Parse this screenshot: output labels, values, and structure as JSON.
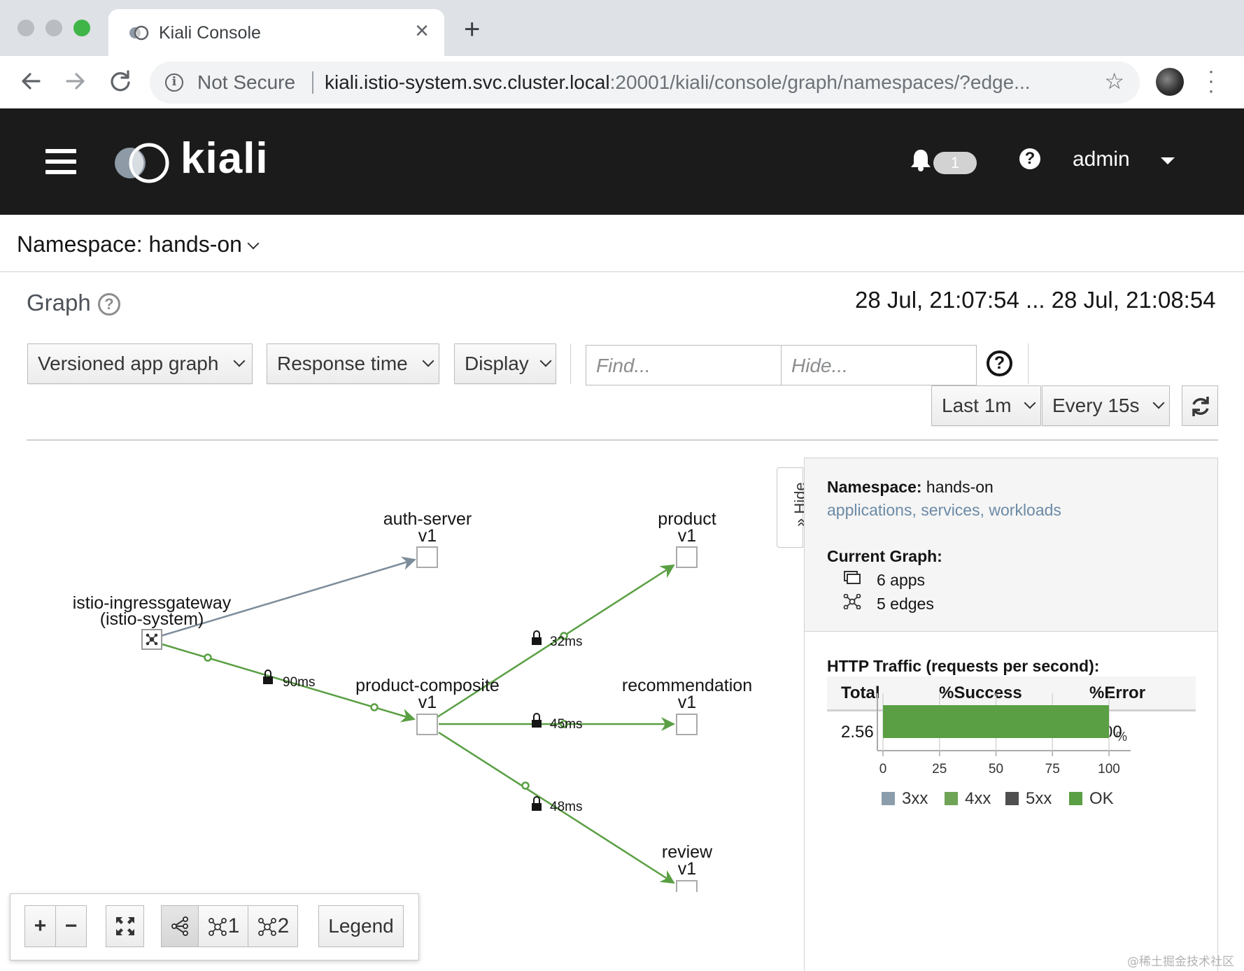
{
  "browser": {
    "tab_title": "Kiali Console",
    "url_host": "kiali.istio-system.svc.cluster.local",
    "url_rest": ":20001/kiali/console/graph/namespaces/?edge...",
    "security_label": "Not Secure"
  },
  "header": {
    "brand": "kiali",
    "notification_count": "1",
    "user": "admin"
  },
  "namespace_bar": {
    "label": "Namespace: hands-on"
  },
  "page": {
    "title": "Graph",
    "time_range": "28 Jul, 21:07:54 ... 28 Jul, 21:08:54"
  },
  "toolbar": {
    "graph_type": "Versioned app graph",
    "edge_label": "Response time",
    "display": "Display",
    "find_placeholder": "Find...",
    "hide_placeholder": "Hide...",
    "duration": "Last 1m",
    "refresh_interval": "Every 15s"
  },
  "graph": {
    "nodes": {
      "ingress_name": "istio-ingressgateway",
      "ingress_ns": "(istio-system)",
      "auth_name": "auth-server",
      "auth_ver": "v1",
      "product_name": "product",
      "product_ver": "v1",
      "composite_name": "product-composite",
      "composite_ver": "v1",
      "recommendation_name": "recommendation",
      "recommendation_ver": "v1",
      "review_name": "review",
      "review_ver": "v1"
    },
    "edges": {
      "ingress_composite": "90ms",
      "composite_product": "32ms",
      "composite_recommendation": "45ms",
      "composite_review": "48ms"
    },
    "colors": {
      "healthy_edge": "#5a9f43",
      "idle_edge": "#7d8c9a"
    }
  },
  "graph_tools": {
    "zoom_in": "+",
    "zoom_out": "−",
    "layout1": "1",
    "layout2": "2",
    "legend": "Legend"
  },
  "side_panel": {
    "hide_label": "» Hide",
    "namespace_key": "Namespace:",
    "namespace_value": "hands-on",
    "links": "applications, services, workloads",
    "current_graph_title": "Current Graph:",
    "apps": "6 apps",
    "edges": "5 edges",
    "http_title": "HTTP Traffic (requests per second):",
    "table_headers": [
      "Total",
      "%Success",
      "%Error"
    ],
    "table_values": [
      "2.56",
      "100.00",
      "0.00"
    ]
  },
  "chart_data": {
    "type": "bar",
    "orientation": "horizontal",
    "stacked": true,
    "xlim": [
      0,
      100
    ],
    "ticks": [
      "0",
      "25",
      "50",
      "75",
      "100"
    ],
    "unit": "%",
    "series": [
      {
        "name": "3xx",
        "values": [
          0
        ],
        "color": "#8b9dab"
      },
      {
        "name": "4xx",
        "values": [
          0
        ],
        "color": "#6fa355"
      },
      {
        "name": "5xx",
        "values": [
          0
        ],
        "color": "#4f4f4f"
      },
      {
        "name": "OK",
        "values": [
          100
        ],
        "color": "#5a9f43"
      }
    ],
    "legend": "bottom"
  },
  "watermark": "@稀土掘金技术社区"
}
